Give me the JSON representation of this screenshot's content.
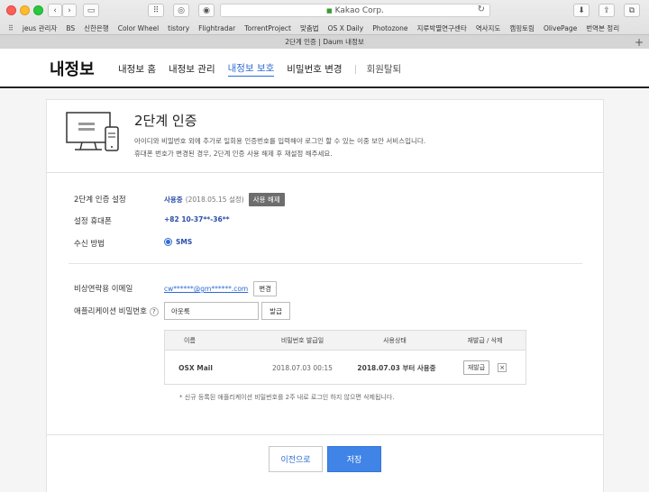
{
  "browser": {
    "url": "Kakao Corp.",
    "tab_title": "2단계 인증 | Daum 내정보",
    "bookmarks": [
      "jeus 관리자",
      "BS",
      "신한은행",
      "Color Wheel",
      "tistory",
      "Flightradar",
      "TorrentProject",
      "맞춤법",
      "OS X Daily",
      "Photozone",
      "지루박멸연구센타",
      "역사지도",
      "캠핑토림",
      "OlivePage",
      "번역본 정리"
    ]
  },
  "header": {
    "logo": "내정보",
    "nav": [
      "내정보 홈",
      "내정보 관리",
      "내정보 보호",
      "비밀번호 변경",
      "회원탈퇴"
    ]
  },
  "intro": {
    "title": "2단계 인증",
    "desc1": "아이디와 비밀번호 외에 추가로 일회용 인증번호를 입력해야 로그인 할 수 있는 이중 보안 서비스입니다.",
    "desc2": "휴대폰 번호가 변경된 경우, 2단계 인증 사용 해제 후 재설정 해주세요."
  },
  "settings": {
    "auth_label": "2단계 인증 설정",
    "auth_status": "사용중",
    "auth_date": "(2018.05.15 설정)",
    "auth_btn": "사용 해제",
    "phone_label": "설정 휴대폰",
    "phone_value": "+82 10-37**-36**",
    "method_label": "수신 방법",
    "method_value": "SMS",
    "email_label": "비상연락용 이메일",
    "email_value": "cw******@gm******.com",
    "email_btn": "변경",
    "apppw_label": "애플리케이션 비밀번호",
    "apppw_help": "?",
    "apppw_input": "아웃룩",
    "apppw_btn": "발급"
  },
  "table": {
    "headers": [
      "이름",
      "비밀번호 발급일",
      "사용상태",
      "재발급 / 삭제"
    ],
    "rows": [
      {
        "name": "OSX Mail",
        "date": "2018.07.03 00:15",
        "status": "2018.07.03 부터 사용중",
        "reissue": "재발급",
        "delete": "×"
      }
    ]
  },
  "note": "* 신규 등록된 애플리케이션 비밀번호를 2주 내로 로그인 하지 않으면 삭제됩니다.",
  "buttons": {
    "prev": "이전으로",
    "save": "저장"
  }
}
